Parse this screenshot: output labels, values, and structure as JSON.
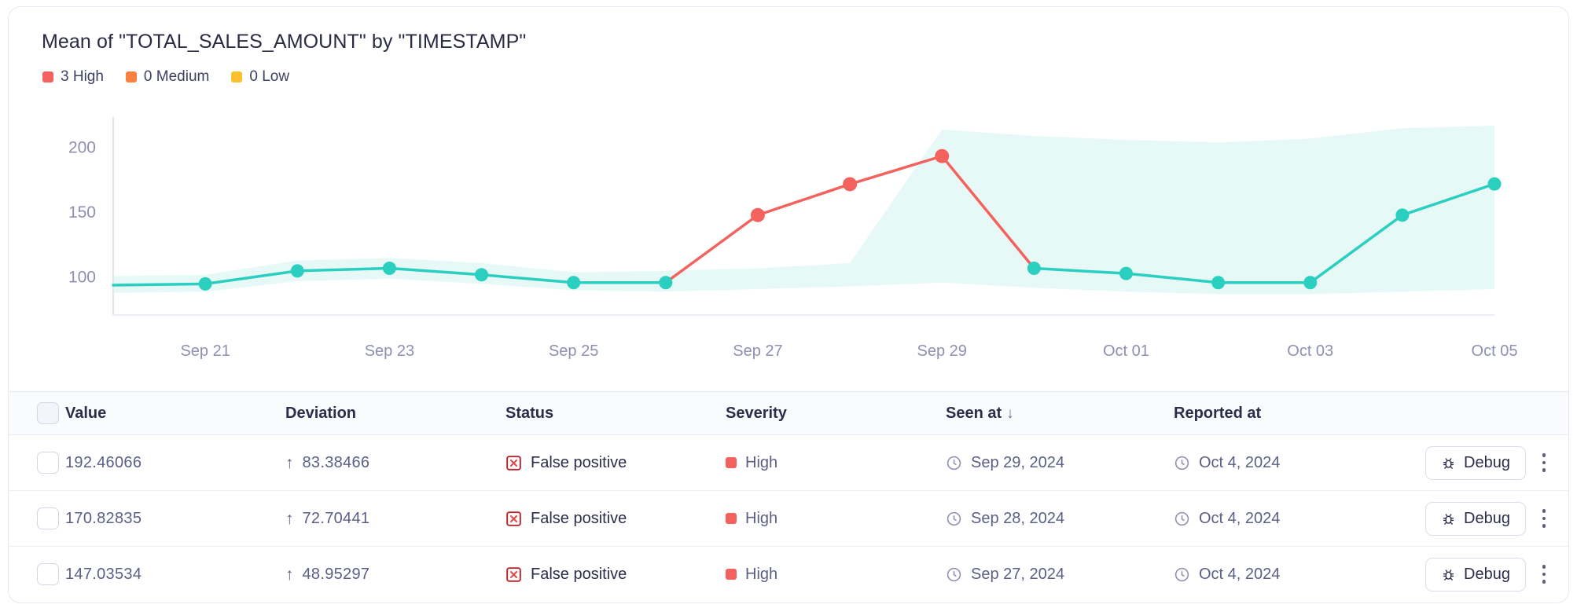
{
  "chart_card": {
    "title": "Mean of \"TOTAL_SALES_AMOUNT\" by \"TIMESTAMP\"",
    "legend": [
      {
        "label": "3 High",
        "color": "#f4625e"
      },
      {
        "label": "0 Medium",
        "color": "#f9813f"
      },
      {
        "label": "0 Low",
        "color": "#fbc02d"
      }
    ]
  },
  "chart_data": {
    "type": "line",
    "title": "Mean of \"TOTAL_SALES_AMOUNT\" by \"TIMESTAMP\"",
    "xlabel": "",
    "ylabel": "",
    "ylim": [
      70,
      225
    ],
    "yticks": [
      100,
      150,
      200
    ],
    "ytick_labels": [
      "100",
      "150",
      "200"
    ],
    "grid": false,
    "legend_position": "top-left",
    "x": [
      "Sep 20",
      "Sep 21",
      "Sep 22",
      "Sep 23",
      "Sep 24",
      "Sep 25",
      "Sep 26",
      "Sep 27",
      "Sep 28",
      "Sep 29",
      "Sep 30",
      "Oct 01",
      "Oct 02",
      "Oct 03",
      "Oct 04",
      "Oct 05"
    ],
    "xtick_labels": [
      "Sep 21",
      "Sep 23",
      "Sep 25",
      "Sep 27",
      "Sep 29",
      "Oct 01",
      "Oct 03",
      "Oct 05"
    ],
    "series": [
      {
        "name": "Mean of TOTAL_SALES_AMOUNT",
        "color": "#2bcfc0",
        "values": [
          93,
          94,
          104,
          106,
          101,
          95,
          95,
          147.03534,
          170.82835,
          192.46066,
          106,
          102,
          95,
          95,
          147,
          171
        ]
      },
      {
        "name": "Anomaly band upper",
        "color": "#e6f9f7",
        "values": [
          100,
          101,
          112,
          114,
          110,
          103,
          104,
          106,
          110,
          213,
          208,
          205,
          203,
          206,
          214,
          216
        ]
      },
      {
        "name": "Anomaly band lower",
        "color": "#e6f9f7",
        "values": [
          87,
          88,
          96,
          98,
          94,
          89,
          88,
          90,
          92,
          95,
          91,
          88,
          86,
          86,
          88,
          90
        ]
      }
    ],
    "anomalies": {
      "color": "#f4625e",
      "points": [
        {
          "x": "Sep 27",
          "y": 147.03534
        },
        {
          "x": "Sep 28",
          "y": 170.82835
        },
        {
          "x": "Sep 29",
          "y": 192.46066
        }
      ]
    }
  },
  "table": {
    "columns": [
      {
        "key": "checkbox",
        "label": ""
      },
      {
        "key": "value",
        "label": "Value"
      },
      {
        "key": "deviation",
        "label": "Deviation"
      },
      {
        "key": "status",
        "label": "Status"
      },
      {
        "key": "severity",
        "label": "Severity"
      },
      {
        "key": "seen_at",
        "label": "Seen at",
        "sorted": "desc",
        "sort_glyph": "↓"
      },
      {
        "key": "reported_at",
        "label": "Reported at"
      },
      {
        "key": "actions",
        "label": ""
      }
    ],
    "rows": [
      {
        "value": "192.46066",
        "deviation": "83.38466",
        "deviation_direction": "↑",
        "status": "False positive",
        "severity": "High",
        "severity_color": "#f4625e",
        "seen_at": "Sep 29, 2024",
        "reported_at": "Oct 4, 2024",
        "action_label": "Debug"
      },
      {
        "value": "170.82835",
        "deviation": "72.70441",
        "deviation_direction": "↑",
        "status": "False positive",
        "severity": "High",
        "severity_color": "#f4625e",
        "seen_at": "Sep 28, 2024",
        "reported_at": "Oct 4, 2024",
        "action_label": "Debug"
      },
      {
        "value": "147.03534",
        "deviation": "48.95297",
        "deviation_direction": "↑",
        "status": "False positive",
        "severity": "High",
        "severity_color": "#f4625e",
        "seen_at": "Sep 27, 2024",
        "reported_at": "Oct 4, 2024",
        "action_label": "Debug"
      }
    ]
  }
}
